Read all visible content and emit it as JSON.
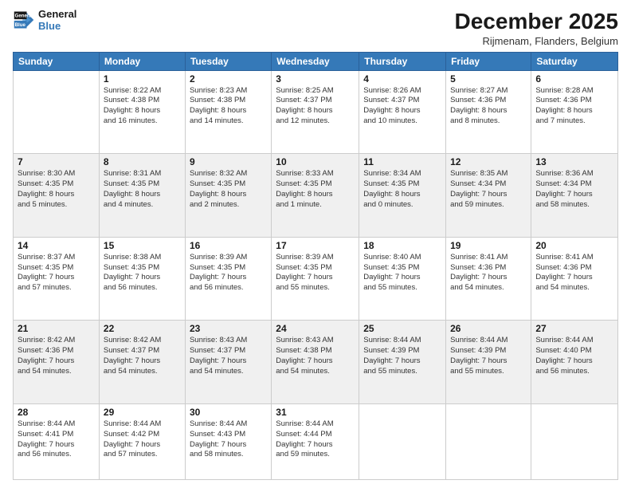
{
  "logo": {
    "line1": "General",
    "line2": "Blue"
  },
  "header": {
    "title": "December 2025",
    "location": "Rijmenam, Flanders, Belgium"
  },
  "weekdays": [
    "Sunday",
    "Monday",
    "Tuesday",
    "Wednesday",
    "Thursday",
    "Friday",
    "Saturday"
  ],
  "weeks": [
    [
      {
        "day": "",
        "info": ""
      },
      {
        "day": "1",
        "info": "Sunrise: 8:22 AM\nSunset: 4:38 PM\nDaylight: 8 hours\nand 16 minutes."
      },
      {
        "day": "2",
        "info": "Sunrise: 8:23 AM\nSunset: 4:38 PM\nDaylight: 8 hours\nand 14 minutes."
      },
      {
        "day": "3",
        "info": "Sunrise: 8:25 AM\nSunset: 4:37 PM\nDaylight: 8 hours\nand 12 minutes."
      },
      {
        "day": "4",
        "info": "Sunrise: 8:26 AM\nSunset: 4:37 PM\nDaylight: 8 hours\nand 10 minutes."
      },
      {
        "day": "5",
        "info": "Sunrise: 8:27 AM\nSunset: 4:36 PM\nDaylight: 8 hours\nand 8 minutes."
      },
      {
        "day": "6",
        "info": "Sunrise: 8:28 AM\nSunset: 4:36 PM\nDaylight: 8 hours\nand 7 minutes."
      }
    ],
    [
      {
        "day": "7",
        "info": "Sunrise: 8:30 AM\nSunset: 4:35 PM\nDaylight: 8 hours\nand 5 minutes."
      },
      {
        "day": "8",
        "info": "Sunrise: 8:31 AM\nSunset: 4:35 PM\nDaylight: 8 hours\nand 4 minutes."
      },
      {
        "day": "9",
        "info": "Sunrise: 8:32 AM\nSunset: 4:35 PM\nDaylight: 8 hours\nand 2 minutes."
      },
      {
        "day": "10",
        "info": "Sunrise: 8:33 AM\nSunset: 4:35 PM\nDaylight: 8 hours\nand 1 minute."
      },
      {
        "day": "11",
        "info": "Sunrise: 8:34 AM\nSunset: 4:35 PM\nDaylight: 8 hours\nand 0 minutes."
      },
      {
        "day": "12",
        "info": "Sunrise: 8:35 AM\nSunset: 4:34 PM\nDaylight: 7 hours\nand 59 minutes."
      },
      {
        "day": "13",
        "info": "Sunrise: 8:36 AM\nSunset: 4:34 PM\nDaylight: 7 hours\nand 58 minutes."
      }
    ],
    [
      {
        "day": "14",
        "info": "Sunrise: 8:37 AM\nSunset: 4:35 PM\nDaylight: 7 hours\nand 57 minutes."
      },
      {
        "day": "15",
        "info": "Sunrise: 8:38 AM\nSunset: 4:35 PM\nDaylight: 7 hours\nand 56 minutes."
      },
      {
        "day": "16",
        "info": "Sunrise: 8:39 AM\nSunset: 4:35 PM\nDaylight: 7 hours\nand 56 minutes."
      },
      {
        "day": "17",
        "info": "Sunrise: 8:39 AM\nSunset: 4:35 PM\nDaylight: 7 hours\nand 55 minutes."
      },
      {
        "day": "18",
        "info": "Sunrise: 8:40 AM\nSunset: 4:35 PM\nDaylight: 7 hours\nand 55 minutes."
      },
      {
        "day": "19",
        "info": "Sunrise: 8:41 AM\nSunset: 4:36 PM\nDaylight: 7 hours\nand 54 minutes."
      },
      {
        "day": "20",
        "info": "Sunrise: 8:41 AM\nSunset: 4:36 PM\nDaylight: 7 hours\nand 54 minutes."
      }
    ],
    [
      {
        "day": "21",
        "info": "Sunrise: 8:42 AM\nSunset: 4:36 PM\nDaylight: 7 hours\nand 54 minutes."
      },
      {
        "day": "22",
        "info": "Sunrise: 8:42 AM\nSunset: 4:37 PM\nDaylight: 7 hours\nand 54 minutes."
      },
      {
        "day": "23",
        "info": "Sunrise: 8:43 AM\nSunset: 4:37 PM\nDaylight: 7 hours\nand 54 minutes."
      },
      {
        "day": "24",
        "info": "Sunrise: 8:43 AM\nSunset: 4:38 PM\nDaylight: 7 hours\nand 54 minutes."
      },
      {
        "day": "25",
        "info": "Sunrise: 8:44 AM\nSunset: 4:39 PM\nDaylight: 7 hours\nand 55 minutes."
      },
      {
        "day": "26",
        "info": "Sunrise: 8:44 AM\nSunset: 4:39 PM\nDaylight: 7 hours\nand 55 minutes."
      },
      {
        "day": "27",
        "info": "Sunrise: 8:44 AM\nSunset: 4:40 PM\nDaylight: 7 hours\nand 56 minutes."
      }
    ],
    [
      {
        "day": "28",
        "info": "Sunrise: 8:44 AM\nSunset: 4:41 PM\nDaylight: 7 hours\nand 56 minutes."
      },
      {
        "day": "29",
        "info": "Sunrise: 8:44 AM\nSunset: 4:42 PM\nDaylight: 7 hours\nand 57 minutes."
      },
      {
        "day": "30",
        "info": "Sunrise: 8:44 AM\nSunset: 4:43 PM\nDaylight: 7 hours\nand 58 minutes."
      },
      {
        "day": "31",
        "info": "Sunrise: 8:44 AM\nSunset: 4:44 PM\nDaylight: 7 hours\nand 59 minutes."
      },
      {
        "day": "",
        "info": ""
      },
      {
        "day": "",
        "info": ""
      },
      {
        "day": "",
        "info": ""
      }
    ]
  ]
}
